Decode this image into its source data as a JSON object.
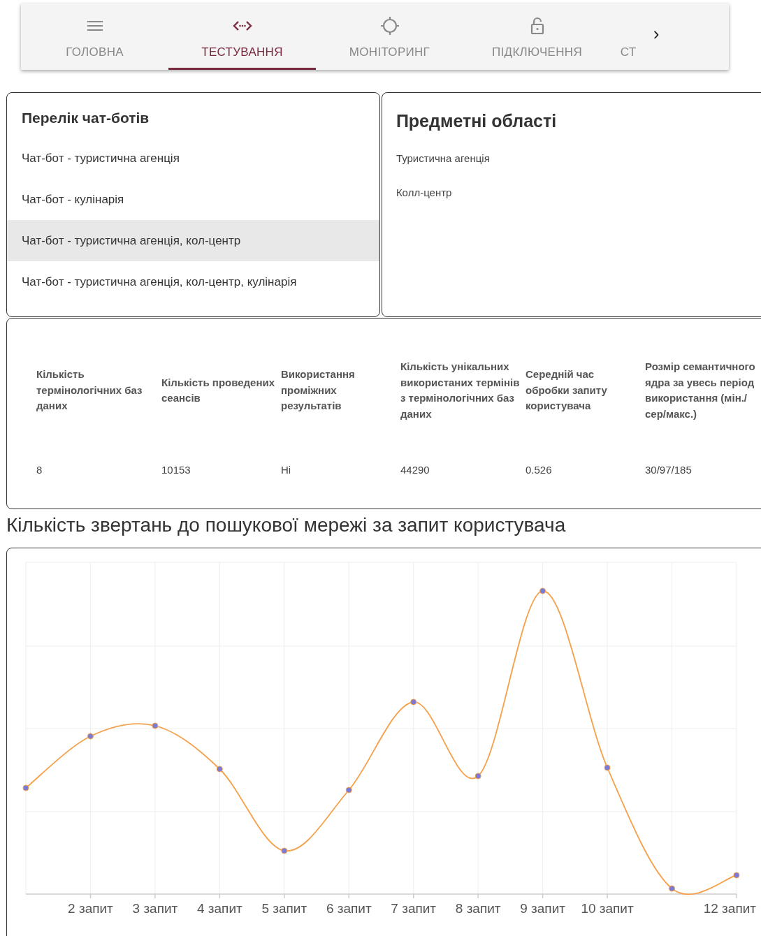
{
  "nav": {
    "tabs": [
      {
        "label": "ГОЛОВНА",
        "kind": "icon",
        "selected": false
      },
      {
        "label": "ТЕСТУВАННЯ",
        "kind": "icon",
        "selected": true
      },
      {
        "label": "МОНІТОРИНГ",
        "kind": "icon",
        "selected": false
      },
      {
        "label": "ПІДКЛЮЧЕННЯ",
        "kind": "icon",
        "selected": false
      },
      {
        "label": "СТ",
        "kind": "text",
        "selected": false
      }
    ],
    "next": "›"
  },
  "chatbots": {
    "title": "Перелік чат-ботів",
    "items": [
      {
        "label": "Чат-бот - туристична агенція",
        "selected": false
      },
      {
        "label": "Чат-бот - кулінарія",
        "selected": false
      },
      {
        "label": "Чат-бот - туристична агенція, кол-центр",
        "selected": true
      },
      {
        "label": "Чат-бот - туристична агенція, кол-центр, кулінарія",
        "selected": false
      }
    ]
  },
  "domains": {
    "title": "Предметні області",
    "items": [
      "Туристична агенція",
      "Колл-центр"
    ]
  },
  "stats": {
    "columns": [
      "Кількість термінологічних баз даних",
      "Кількість проведених сеансів",
      "Використання проміжних результатів",
      "Кількість унікальних використаних термінів з термінологічних баз даних",
      "Середній час обробки запиту користувача",
      "Розмір семантичного ядра за увесь період використання (мін./сер/макс.)"
    ],
    "values": [
      "8",
      "10153",
      "Ні",
      "44290",
      "0.526",
      "30/97/185"
    ]
  },
  "chart": {
    "title": "Кількість звертань до пошукової мережі за запит користувача",
    "x_labels": [
      "2 запит",
      "3 запит",
      "4 запит",
      "5 запит",
      "6 запит",
      "7 запит",
      "8 запит",
      "9 запит",
      "10 запит",
      "12 запит"
    ]
  }
}
